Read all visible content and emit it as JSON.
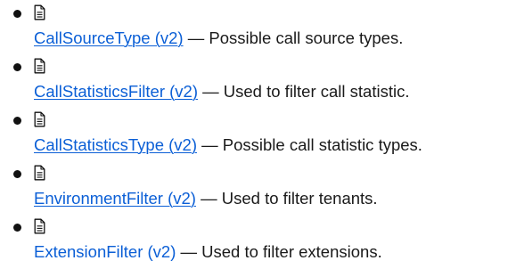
{
  "items": [
    {
      "icon": "document-icon",
      "link_text": "CallSourceType (v2)",
      "description": " — Possible call source types."
    },
    {
      "icon": "document-icon",
      "link_text": "CallStatisticsFilter (v2)",
      "description": " — Used to filter call statistic."
    },
    {
      "icon": "document-icon",
      "link_text": "CallStatisticsType (v2)",
      "description": " — Possible call statistic types."
    },
    {
      "icon": "document-icon",
      "link_text": "EnvironmentFilter (v2)",
      "description": " — Used to filter tenants."
    },
    {
      "icon": "document-icon",
      "link_text": "ExtensionFilter (v2)",
      "description": " — Used to filter extensions."
    }
  ],
  "colors": {
    "link": "#0b5fd6",
    "text": "#1a1a1a"
  }
}
